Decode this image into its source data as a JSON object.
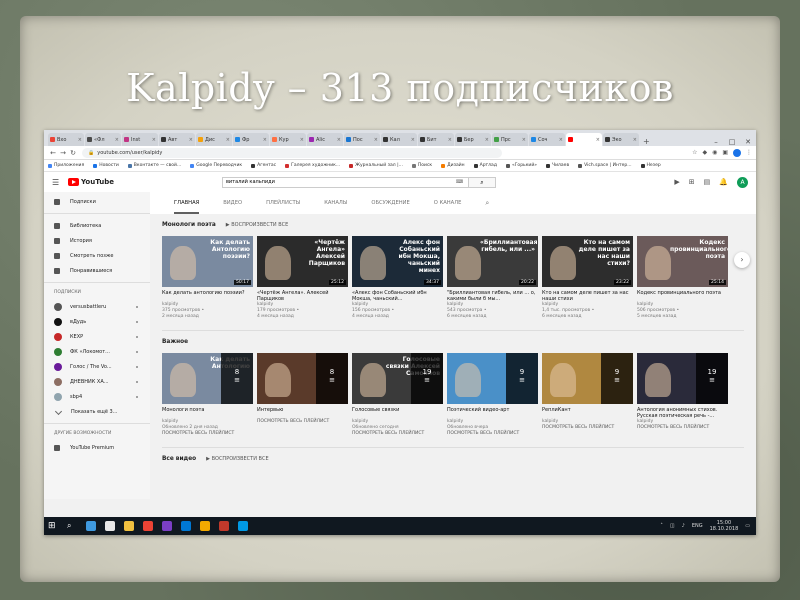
{
  "slide": {
    "title": "Kalpidy – 313 подписчиков"
  },
  "browser": {
    "tabs": [
      {
        "label": "Вхо",
        "color": "#ea4335"
      },
      {
        "label": "«Фл",
        "color": "#4a4a4a"
      },
      {
        "label": "Inst",
        "color": "#c13584"
      },
      {
        "label": "Авт",
        "color": "#333333"
      },
      {
        "label": "Дис",
        "color": "#f4a10b"
      },
      {
        "label": "Фр",
        "color": "#1e88e5"
      },
      {
        "label": "Кур",
        "color": "#ff7043"
      },
      {
        "label": "Alic",
        "color": "#9c27b0"
      },
      {
        "label": "Пос",
        "color": "#1976d2"
      },
      {
        "label": "Кал",
        "color": "#333333"
      },
      {
        "label": "Бит",
        "color": "#333333"
      },
      {
        "label": "Бер",
        "color": "#333333"
      },
      {
        "label": "Прс",
        "color": "#43a047"
      },
      {
        "label": "Соч",
        "color": "#1e88e5"
      },
      {
        "label": "",
        "color": "#ff0000",
        "active": true
      },
      {
        "label": "Эко",
        "color": "#333333"
      }
    ],
    "url": "youtube.com/user/kalpidy",
    "bookmarks": [
      {
        "label": "Приложения",
        "color": "#4285f4"
      },
      {
        "label": "Новости",
        "color": "#1a73e8"
      },
      {
        "label": "Вконтакте — свой...",
        "color": "#4a76a8"
      },
      {
        "label": "Google Переводчик",
        "color": "#4285f4"
      },
      {
        "label": "Агентас",
        "color": "#333333"
      },
      {
        "label": "Галерея художник...",
        "color": "#d32f2f"
      },
      {
        "label": "Журнальный зал |...",
        "color": "#c62828"
      },
      {
        "label": "Поиск",
        "color": "#777777"
      },
      {
        "label": "Дизайн",
        "color": "#f57c00"
      },
      {
        "label": "Артлад",
        "color": "#333333"
      },
      {
        "label": "«Горький»",
        "color": "#555555"
      },
      {
        "label": "Чилаев",
        "color": "#333333"
      },
      {
        "label": "Vich.space | Интер...",
        "color": "#555555"
      },
      {
        "label": "Незер",
        "color": "#333333"
      }
    ]
  },
  "youtube": {
    "logo": "YouTube",
    "search_value": "виталий кальпиди",
    "avatar_letter": "A",
    "sidebar": {
      "top": [
        {
          "label": "Подписки",
          "icon": "subscriptions-icon"
        }
      ],
      "library": [
        {
          "label": "Библиотека",
          "icon": "library-icon"
        },
        {
          "label": "История",
          "icon": "history-icon"
        },
        {
          "label": "Смотреть позже",
          "icon": "watch-later-icon"
        },
        {
          "label": "Понравившиеся",
          "icon": "thumbs-up-icon"
        }
      ],
      "subscriptions_header": "ПОДПИСКИ",
      "subscriptions": [
        {
          "label": "versusbattleru",
          "color": "#555555"
        },
        {
          "label": "вДудь",
          "color": "#111111"
        },
        {
          "label": "КЕХР",
          "color": "#c62828"
        },
        {
          "label": "ФК «Локомот...",
          "color": "#2e7d32"
        },
        {
          "label": "Голос / The Vo...",
          "color": "#6a1b9a"
        },
        {
          "label": "ДНЕВНИК ХА...",
          "color": "#8d6e63"
        },
        {
          "label": "sbp4",
          "color": "#90a4ae"
        },
        {
          "label": "Показать ещё 3...",
          "color": ""
        }
      ],
      "other_header": "ДРУГИЕ ВОЗМОЖНОСТИ",
      "other": [
        {
          "label": "YouTube Premium",
          "icon": "youtube-premium-icon"
        }
      ]
    },
    "channel_tabs": [
      "ГЛАВНАЯ",
      "ВИДЕО",
      "ПЛЕЙЛИСТЫ",
      "КАНАЛЫ",
      "ОБСУЖДЕНИЕ",
      "О КАНАЛЕ"
    ],
    "sections": [
      {
        "title": "Монологи поэта",
        "play_all": "ВОСПРОИЗВЕСТИ ВСЕ",
        "videos": [
          {
            "overlay": "Как делать Антологию поэзии?",
            "duration": "50:17",
            "title": "Как делать антологию поэзии?",
            "channel": "kalpidy",
            "views": "375 просмотров •",
            "age": "2 месяца назад",
            "bg": "#7a8aa0"
          },
          {
            "overlay": "«Чертёж Ангела» Алексей Парщиков",
            "duration": "25:12",
            "title": "«Чертёж Ангела». Алексей Парщиков",
            "channel": "kalpidy",
            "views": "179 просмотров •",
            "age": "4 месяца назад",
            "bg": "#2b2b2b"
          },
          {
            "overlay": "Алекс фон Собаньский ибн Мокша, чаньский минех",
            "duration": "34:37",
            "title": "«Алекс фон Собаньский ибн Мокша, чаньский...",
            "channel": "kalpidy",
            "views": "156 просмотров •",
            "age": "4 месяца назад",
            "bg": "#1c2a38"
          },
          {
            "overlay": "«Бриллиантовая гибель, или ...»",
            "duration": "20:22",
            "title": "\"Бриллиантовая гибель, или ... о, кaкими были б мы...",
            "channel": "kalpidy",
            "views": "543 просмотра •",
            "age": "6 месяцев назад",
            "bg": "#3a3a3a"
          },
          {
            "overlay": "Кто на самом деле пишет за нас наши стихи?",
            "duration": "23:22",
            "title": "Кто на самом деле пишет за нас наши стихи",
            "channel": "kalpidy",
            "views": "1,4 тыс. просмотров •",
            "age": "6 месяцев назад",
            "bg": "#2d2d2d"
          },
          {
            "overlay": "Кодекс провинциального поэта",
            "duration": "25:14",
            "title": "Кодекс провинциального поэта",
            "channel": "kalpidy",
            "views": "506 просмотров •",
            "age": "5 месяцев назад",
            "bg": "#6b5a5a"
          }
        ]
      },
      {
        "title": "Важное",
        "play_all": "",
        "videos": [
          {
            "overlay": "Как делать Антологию",
            "count": "8",
            "title": "Монологи поэта",
            "channel": "kalpidy",
            "views": "Обновлено 2 дня назад",
            "age": "ПОСМОТРЕТЬ ВЕСЬ ПЛЕЙЛИСТ",
            "bg": "#7a8aa0"
          },
          {
            "overlay": "",
            "count": "8",
            "title": "Интервью",
            "channel": "",
            "views": "",
            "age": "ПОСМОТРЕТЬ ВЕСЬ ПЛЕЙЛИСТ",
            "bg": "#5a3a2a"
          },
          {
            "overlay": "Голосовые связки Алексей Самойлов",
            "count": "19",
            "title": "Голосовые связки",
            "channel": "kalpidy",
            "views": "Обновлено сегодня",
            "age": "ПОСМОТРЕТЬ ВЕСЬ ПЛЕЙЛИСТ",
            "bg": "#3a3a3a"
          },
          {
            "overlay": "",
            "count": "9",
            "title": "Поэтический видео-арт",
            "channel": "kalpidy",
            "views": "Обновлено вчера",
            "age": "ПОСМОТРЕТЬ ВЕСЬ ПЛЕЙЛИСТ",
            "bg": "#4a90c8"
          },
          {
            "overlay": "",
            "count": "9",
            "title": "РеплиКант",
            "channel": "kalpidy",
            "views": "",
            "age": "ПОСМОТРЕТЬ ВЕСЬ ПЛЕЙЛИСТ",
            "bg": "#b08840"
          },
          {
            "overlay": "",
            "count": "19",
            "title": "Антология анонимных стихов. Русская поэтическая речь -...",
            "channel": "kalpidy",
            "views": "",
            "age": "ПОСМОТРЕТЬ ВЕСЬ ПЛЕЙЛИСТ",
            "bg": "#2a2a3a"
          }
        ]
      }
    ],
    "next_section_title": "Все видео",
    "next_section_play_all": "ВОСПРОИЗВЕСТИ ВСЕ"
  },
  "taskbar": {
    "icons": [
      "#3f9ae0",
      "#e8e8e8",
      "#f0c040",
      "#ea4335",
      "#7b3fc4",
      "#0078d4",
      "#f2a900",
      "#c0392b",
      "#0099e5"
    ],
    "lang": "ENG",
    "time": "15:00",
    "date": "18.10.2018"
  }
}
